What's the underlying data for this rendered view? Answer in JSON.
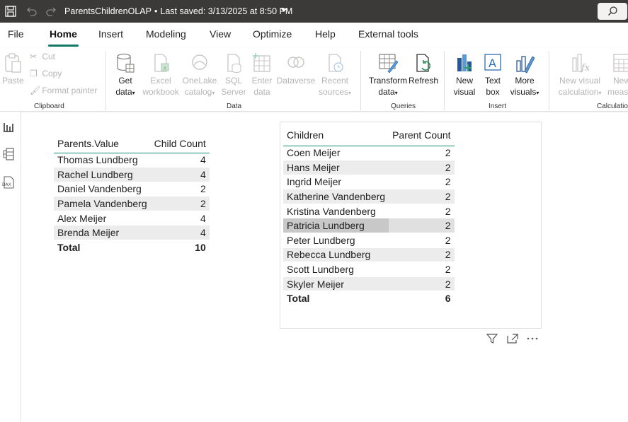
{
  "titlebar": {
    "file_name": "ParentsChildrenOLAP",
    "separator": "•",
    "last_saved": "Last saved: 3/13/2025 at 8:50 PM",
    "icons": [
      "save-icon",
      "undo-icon",
      "redo-icon",
      "search-icon"
    ]
  },
  "menu": {
    "tabs": [
      "File",
      "Home",
      "Insert",
      "Modeling",
      "View",
      "Optimize",
      "Help",
      "External tools"
    ],
    "active": "Home"
  },
  "ribbon": {
    "clipboard": {
      "label": "Clipboard",
      "paste": "Paste",
      "cut": "Cut",
      "copy": "Copy",
      "format_painter": "Format painter"
    },
    "data": {
      "label": "Data",
      "get_data": [
        "Get",
        "data"
      ],
      "excel": [
        "Excel",
        "workbook"
      ],
      "onelake": [
        "OneLake",
        "catalog"
      ],
      "sql": [
        "SQL",
        "Server"
      ],
      "enter": [
        "Enter",
        "data"
      ],
      "dataverse": "Dataverse",
      "recent": [
        "Recent",
        "sources"
      ]
    },
    "queries": {
      "label": "Queries",
      "transform": [
        "Transform",
        "data"
      ],
      "refresh": "Refresh"
    },
    "insert": {
      "label": "Insert",
      "new_visual": [
        "New",
        "visual"
      ],
      "text_box": [
        "Text",
        "box"
      ],
      "more_visuals": [
        "More",
        "visuals"
      ]
    },
    "calculations": {
      "label": "Calculation",
      "new_visual_calc": [
        "New visual",
        "calculation"
      ],
      "new_measure": [
        "New",
        "meas"
      ]
    }
  },
  "table1": {
    "headers": [
      "Parents.Value",
      "Child Count"
    ],
    "rows": [
      [
        "Thomas Lundberg",
        "4"
      ],
      [
        "Rachel Lundberg",
        "4"
      ],
      [
        "Daniel Vandenberg",
        "2"
      ],
      [
        "Pamela Vandenberg",
        "2"
      ],
      [
        "Alex Meijer",
        "4"
      ],
      [
        "Brenda Meijer",
        "4"
      ]
    ],
    "total": [
      "Total",
      "10"
    ]
  },
  "table2": {
    "headers": [
      "Children",
      "Parent Count"
    ],
    "rows": [
      [
        "Coen Meijer",
        "2"
      ],
      [
        "Hans Meijer",
        "2"
      ],
      [
        "Ingrid Meijer",
        "2"
      ],
      [
        "Katherine Vandenberg",
        "2"
      ],
      [
        "Kristina Vandenberg",
        "2"
      ],
      [
        "Patricia Lundberg",
        "2"
      ],
      [
        "Peter Lundberg",
        "2"
      ],
      [
        "Rebecca Lundberg",
        "2"
      ],
      [
        "Scott Lundberg",
        "2"
      ],
      [
        "Skyler Meijer",
        "2"
      ]
    ],
    "total": [
      "Total",
      "6"
    ],
    "selected_row": "Patricia Lundberg"
  },
  "colors": {
    "titlebar_bg": "#3b3a39",
    "accent": "#117865",
    "header_rule": "#118d7a",
    "total_rule": "#4a90c2",
    "row_band": "#ececec"
  }
}
